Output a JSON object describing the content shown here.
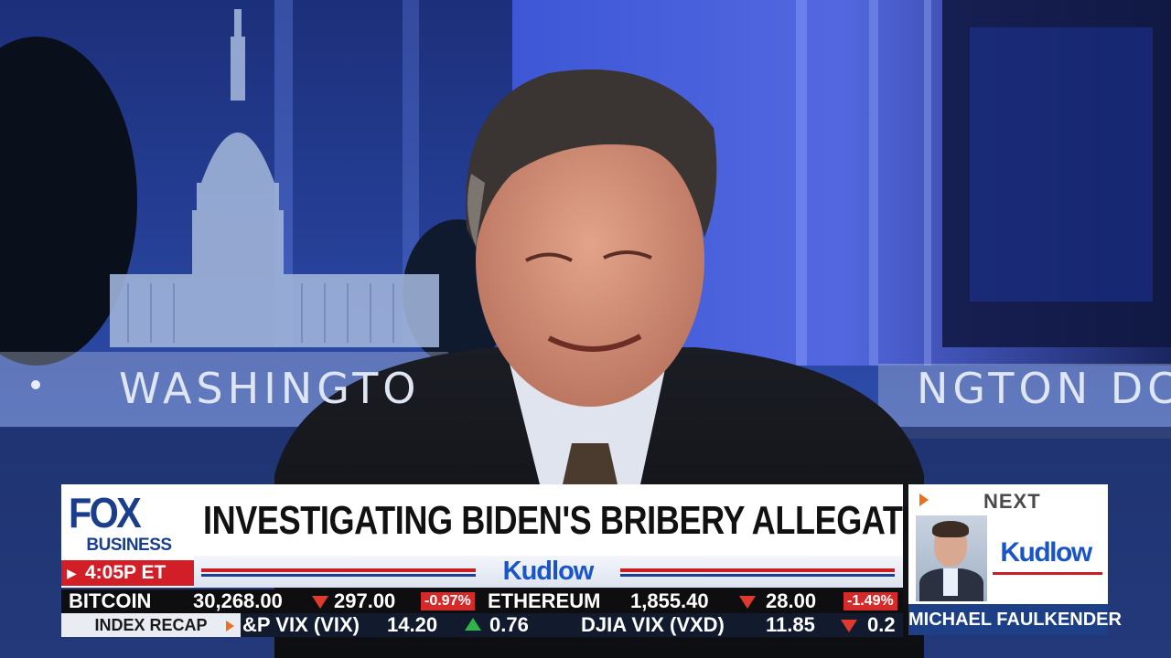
{
  "background": {
    "wall_text_left": "WASHINGTO",
    "wall_text_right": "NGTON DC"
  },
  "headline": "INVESTIGATING BIDEN'S BRIBERY ALLEGATIONS",
  "show_name": "Kudlow",
  "network": {
    "logo_word": "FOX",
    "logo_sub": "BUSINESS",
    "time": "4:05P ET"
  },
  "next_up": {
    "label": "NEXT",
    "show": "Kudlow",
    "guest_name": "MICHAEL FAULKENDER"
  },
  "ticker_crypto": [
    {
      "symbol": "BITCOIN",
      "price": "30,268.00",
      "direction": "down",
      "change": "297.00",
      "pct": "-0.97%"
    },
    {
      "symbol": "ETHEREUM",
      "price": "1,855.40",
      "direction": "down",
      "change": "28.00",
      "pct": "-1.49%"
    }
  ],
  "ticker_index": {
    "label": "INDEX RECAP",
    "items": [
      {
        "symbol": "&P VIX (VIX)",
        "price": "14.20",
        "direction": "up",
        "change": "0.76"
      },
      {
        "symbol": "DJIA VIX (VXD)",
        "price": "11.85",
        "direction": "down",
        "change": "0.2"
      }
    ]
  },
  "colors": {
    "fox_blue": "#1b3e8c",
    "fox_red": "#d21f27",
    "kudlow_blue": "#1a55c8",
    "down_red": "#e03a2f",
    "up_green": "#2fb34a"
  }
}
